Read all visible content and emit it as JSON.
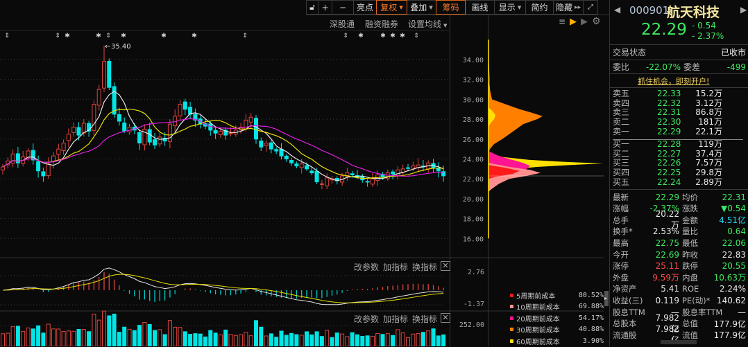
{
  "toolbar": {
    "items": [
      {
        "label": "亮点",
        "active": false,
        "dropdown": false
      },
      {
        "label": "复权",
        "active": true,
        "dropdown": true
      },
      {
        "label": "叠加",
        "active": false,
        "dropdown": true
      },
      {
        "label": "筹码",
        "active": true,
        "dropdown": false
      },
      {
        "label": "画线",
        "active": false,
        "dropdown": false
      },
      {
        "label": "显示",
        "active": false,
        "dropdown": true
      },
      {
        "label": "简约",
        "active": false,
        "dropdown": false
      },
      {
        "label": "隐藏",
        "active": false,
        "dropdown": false
      }
    ],
    "plus": "+",
    "minus": "−",
    "hide_arrows": "▸▸"
  },
  "subbar": {
    "shenguton": "深股通",
    "margin": "融资融券",
    "set_ma": "设置均线"
  },
  "main_chart": {
    "peak_label": "35.40",
    "price_ticks": [
      "34.00",
      "32.00",
      "30.00",
      "28.00",
      "26.00",
      "24.00",
      "22.00",
      "20.00",
      "18.00",
      "16.00"
    ],
    "closes": [
      23.2,
      23.8,
      24.5,
      23.6,
      24.2,
      24.8,
      23.9,
      22.8,
      22.3,
      23.5,
      24.3,
      25.0,
      25.6,
      26.5,
      27.2,
      26.4,
      27.6,
      26.8,
      29.5,
      31.0,
      33.8,
      31.2,
      28.5,
      27.8,
      26.8,
      27.2,
      26.9,
      25.6,
      27.0,
      25.7,
      25.4,
      26.2,
      25.8,
      27.5,
      28.3,
      29.5,
      29.0,
      28.5,
      27.9,
      27.5,
      27.3,
      26.9,
      26.6,
      26.8,
      26.4,
      26.6,
      26.9,
      27.2,
      27.9,
      28.2,
      26.0,
      25.2,
      25.6,
      25.0,
      24.8,
      24.3,
      24.0,
      23.6,
      23.3,
      23.5,
      23.0,
      22.6,
      21.7,
      21.5,
      22.1,
      22.0,
      21.8,
      22.3,
      22.6,
      22.4,
      22.2,
      21.9,
      21.7,
      22.0,
      22.4,
      22.2,
      22.6,
      22.5,
      22.9,
      23.0,
      23.1,
      23.3,
      23.4,
      23.2,
      23.6,
      23.1,
      22.8,
      22.3
    ],
    "colors": {
      "up": "#e0453f",
      "down": "#00e5e5",
      "ma5": "#e8e8e8",
      "ma10": "#e6e000",
      "ma20": "#e020e0"
    }
  },
  "macd_panel": {
    "edit": "改参数",
    "add": "加指标",
    "swap": "换指标",
    "close": "✕",
    "top": "2.76",
    "bottom": "-1.37"
  },
  "volume_panel": {
    "edit": "改参数",
    "add": "加指标",
    "swap": "换指标",
    "close": "✕",
    "top": "252.00"
  },
  "chip_legend": [
    {
      "label": "5周期前成本",
      "pct": "80.52%",
      "color": "#ff1a1a"
    },
    {
      "label": "10周期前成本",
      "pct": "69.88%",
      "color": "#ff8f8f"
    },
    {
      "label": "20周期前成本",
      "pct": "54.17%",
      "color": "#ff1493"
    },
    {
      "label": "30周期前成本",
      "pct": "40.88%",
      "color": "#ff8000"
    },
    {
      "label": "60周期前成本",
      "pct": "3.90%",
      "color": "#ffe000"
    }
  ],
  "quote": {
    "code": "000901",
    "name": "航天科技",
    "price": "22.29",
    "change": "- 0.54",
    "change_pct": "- 2.37%",
    "status_label": "交易状态",
    "status": "已收市",
    "weibi_label": "委比",
    "weibi": "-22.07%",
    "weicha_label": "委差",
    "weicha": "-499",
    "promo": "抓住机会，即刻开户!",
    "asks": [
      {
        "label": "卖五",
        "price": "22.33",
        "vol": "15.2万"
      },
      {
        "label": "卖四",
        "price": "22.32",
        "vol": "3.12万"
      },
      {
        "label": "卖三",
        "price": "22.31",
        "vol": "86.8万"
      },
      {
        "label": "卖二",
        "price": "22.30",
        "vol": "181万"
      },
      {
        "label": "卖一",
        "price": "22.29",
        "vol": "22.1万"
      }
    ],
    "bids": [
      {
        "label": "买一",
        "price": "22.28",
        "vol": "119万"
      },
      {
        "label": "买二",
        "price": "22.27",
        "vol": "37.4万"
      },
      {
        "label": "买三",
        "price": "22.26",
        "vol": "7.57万"
      },
      {
        "label": "买四",
        "price": "22.25",
        "vol": "29.8万"
      },
      {
        "label": "买五",
        "price": "22.24",
        "vol": "2.89万"
      }
    ],
    "stats": [
      [
        {
          "l": "最新",
          "v": "22.29",
          "c": "g"
        },
        {
          "l": "均价",
          "v": "22.31",
          "c": "g"
        }
      ],
      [
        {
          "l": "涨幅",
          "v": "-2.37%",
          "c": "g"
        },
        {
          "l": "涨跌",
          "v": "▼0.54",
          "c": "g"
        }
      ],
      [
        {
          "l": "总手",
          "v": "20.22万",
          "c": "w"
        },
        {
          "l": "金额",
          "v": "4.51亿",
          "c": "c"
        }
      ],
      [
        {
          "l": "换手*",
          "v": "2.53%",
          "c": "w"
        },
        {
          "l": "量比",
          "v": "0.64",
          "c": "g"
        }
      ],
      [
        {
          "l": "最高",
          "v": "22.75",
          "c": "g"
        },
        {
          "l": "最低",
          "v": "22.06",
          "c": "g"
        }
      ],
      [
        {
          "l": "今开",
          "v": "22.69",
          "c": "g"
        },
        {
          "l": "昨收",
          "v": "22.83",
          "c": "w"
        }
      ],
      [
        {
          "l": "涨停",
          "v": "25.11",
          "c": "r"
        },
        {
          "l": "跌停",
          "v": "20.55",
          "c": "g"
        }
      ],
      [
        {
          "l": "外盘",
          "v": "9.59万",
          "c": "r"
        },
        {
          "l": "内盘",
          "v": "10.63万",
          "c": "g"
        }
      ],
      [
        {
          "l": "净资产",
          "v": "5.41",
          "c": "w"
        },
        {
          "l": "ROE",
          "v": "2.24%",
          "c": "w"
        }
      ],
      [
        {
          "l": "收益(三)",
          "v": "0.119",
          "c": "w"
        },
        {
          "l": "PE(动)*",
          "v": "140.62",
          "c": "w"
        }
      ],
      [
        {
          "l": "股息TTM",
          "v": "—",
          "c": "w"
        },
        {
          "l": "股息率TTM",
          "v": "—",
          "c": "w"
        }
      ],
      [
        {
          "l": "总股本",
          "v": "7.982亿",
          "c": "w"
        },
        {
          "l": "总值",
          "v": "177.9亿",
          "c": "w"
        }
      ],
      [
        {
          "l": "流通股",
          "v": "7.982亿",
          "c": "w"
        },
        {
          "l": "流值",
          "v": "177.9亿",
          "c": "w"
        }
      ]
    ]
  }
}
